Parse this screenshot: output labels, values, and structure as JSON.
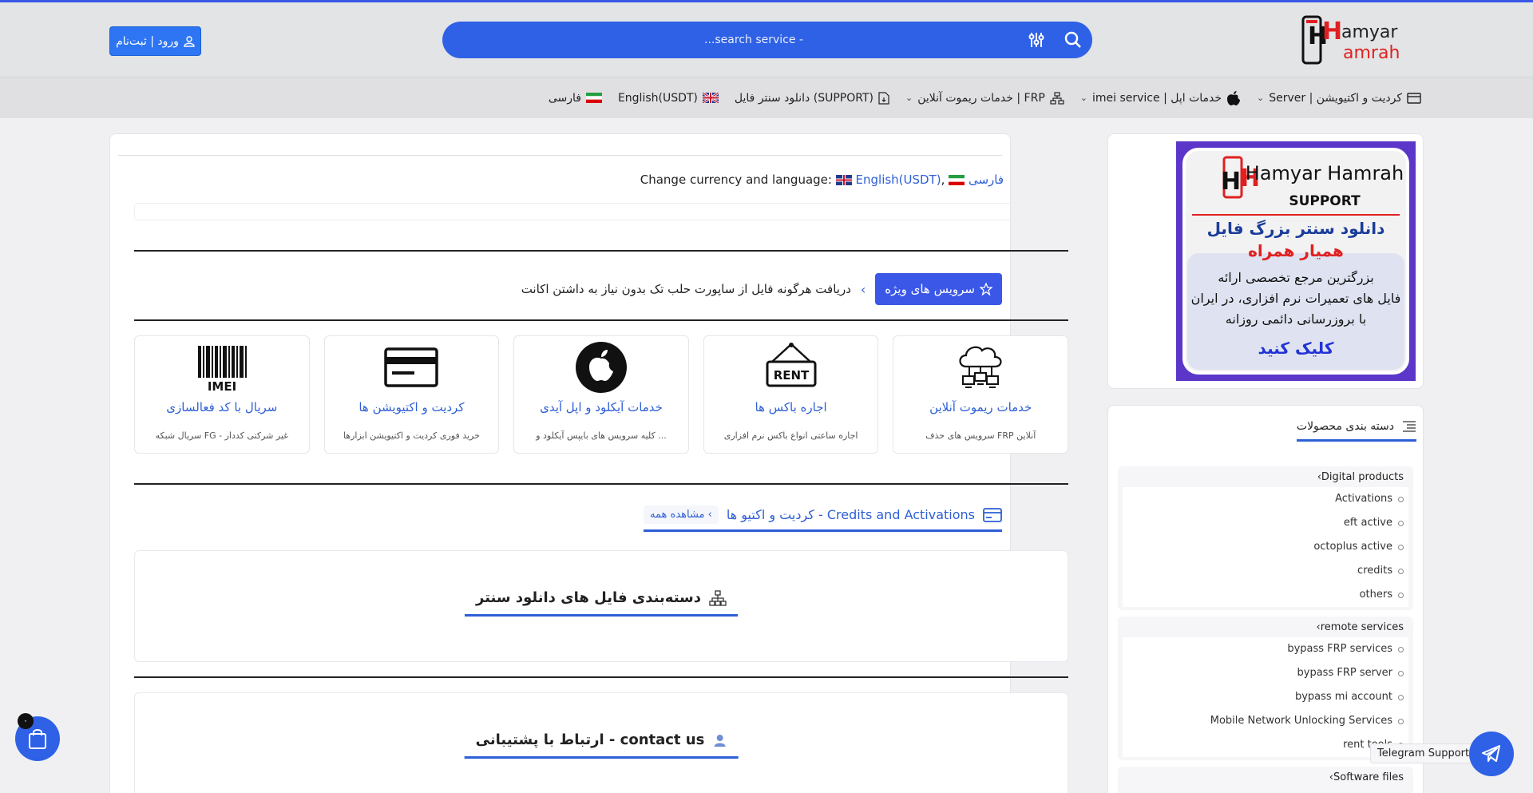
{
  "header": {
    "logo_alt": "Hamyar Hamrah",
    "logo_text_1": "amyar",
    "logo_text_2": "amrah",
    "search_placeholder": "...search service -",
    "login_label": "ورود | ثبت‌نام"
  },
  "nav": {
    "items": [
      {
        "label": "Server | کردیت و اکتیویشن",
        "icon": "card-icon",
        "dropdown": true
      },
      {
        "label": "imei service | خدمات اپل",
        "icon": "apple-icon",
        "dropdown": true
      },
      {
        "label": "خدمات ریموت آنلاین | FRP",
        "icon": "network-icon",
        "dropdown": true
      },
      {
        "label": "دانلود سنتر فایل (SUPPORT)",
        "icon": "file-icon",
        "dropdown": false
      },
      {
        "label": "English(USDT)",
        "icon": "uk-flag-icon",
        "dropdown": false
      },
      {
        "label": "فارسی",
        "icon": "iran-flag-icon",
        "dropdown": false
      }
    ]
  },
  "main": {
    "currency_label": "Change currency and language:",
    "currency_en": "English(USDT)",
    "currency_fa": "فارسی",
    "special_badge": "سرویس های ویژه",
    "special_text": "دریافت هرگونه فایل از ساپورت حلب تک بدون نیاز به داشتن اکانت",
    "cards": [
      {
        "title": "خدمات ریموت آنلاین",
        "subtitle": "سرویس های حذف FRP آنلاین",
        "icon": "cloud-network-icon"
      },
      {
        "title": "اجاره باکس ها",
        "subtitle": "اجاره ساعتی انواع باکس نرم افزاری",
        "icon": "rent-sign-icon",
        "icon_text": "RENT"
      },
      {
        "title": "خدمات آیکلود و اپل آیدی",
        "subtitle": "کلیه سرویس های بایپس آیکلود و ...",
        "icon": "apple-icon"
      },
      {
        "title": "کردیت و اکتیویشن ها",
        "subtitle": "خرید فوری کردیت و اکتیویشن ابزارها",
        "icon": "credit-card-icon"
      },
      {
        "title": "سریال با کد فعالسازی",
        "subtitle": "سریال شبکه FG - غیر شرکتی کددار",
        "icon": "imei-barcode-icon",
        "icon_text": "IMEI"
      }
    ],
    "section_title": "کردیت و اکتیو ها - Credits and Activations",
    "view_all": "مشاهده همه",
    "file_categories_title": "دسته‌بندی فایل های دانلود سنتر",
    "contact_title": "ارتباط با پشتیبانی - contact us"
  },
  "sidebar": {
    "banner": {
      "line1": "دانلود سنتر بزرگ فایل",
      "line2": "همیار همراه",
      "line3": "بزرگترین مرجع تخصصی ارائه",
      "line4": "فایل های تعمیرات نرم افزاری، در ایران",
      "line5": "با بروزرسانی دائمی روزانه",
      "cta": "کلیک کنید",
      "brand": "Hamyar Hamrah",
      "support": "SUPPORT"
    },
    "categories_title": "دسته بندی محصولات",
    "groups": [
      {
        "name": "Digital products",
        "items": [
          "Activations",
          "eft active",
          "octoplus active",
          "credits",
          "others"
        ]
      },
      {
        "name": "remote services",
        "items": [
          "bypass FRP services",
          "bypass FRP server",
          "bypass mi account",
          "Mobile Network Unlocking Services",
          "rent tools"
        ]
      },
      {
        "name": "Software files",
        "items": []
      }
    ]
  },
  "floating": {
    "cart_count": "۰",
    "telegram_label": "Telegram Support"
  },
  "colors": {
    "accent": "#2e61e6",
    "link": "#2d5fd6",
    "header_bg": "#e3e4e6"
  }
}
